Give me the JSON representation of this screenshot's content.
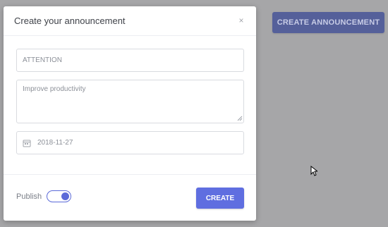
{
  "page": {
    "create_button_label": "CREATE ANNOUNCEMENT"
  },
  "modal": {
    "title": "Create your announcement",
    "close_label": "×",
    "fields": {
      "title_value": "ATTENTION",
      "message_value": "Improve productivity",
      "date_value": "2018-11-27"
    },
    "footer": {
      "publish_label": "Publish",
      "publish_on": true,
      "create_label": "CREATE"
    }
  },
  "icons": {
    "calendar": "calendar-icon",
    "close": "close-icon",
    "cursor": "mouse-cursor-icon"
  },
  "colors": {
    "accent": "#5f6ee0",
    "muted_accent": "#55609a",
    "background": "#a6a6a8"
  }
}
